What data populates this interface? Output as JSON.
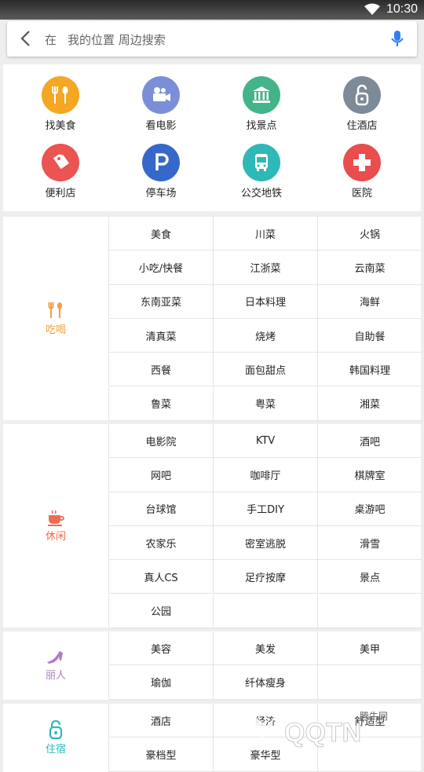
{
  "status_bar": {
    "time": "10:30"
  },
  "search": {
    "prefix": "在",
    "placeholder": "我的位置 周边搜索"
  },
  "quick_categories": [
    {
      "label": "找美食",
      "icon": "fork-spoon-icon",
      "color": "#f5a623"
    },
    {
      "label": "看电影",
      "icon": "movie-camera-icon",
      "color": "#7b8fd8"
    },
    {
      "label": "找景点",
      "icon": "landmark-icon",
      "color": "#43b38a"
    },
    {
      "label": "住酒店",
      "icon": "hotel-key-icon",
      "color": "#7d8a98"
    },
    {
      "label": "便利店",
      "icon": "price-tag-icon",
      "color": "#ea5451"
    },
    {
      "label": "停车场",
      "icon": "parking-icon",
      "color": "#3568c8"
    },
    {
      "label": "公交地铁",
      "icon": "bus-icon",
      "color": "#2fb8b8"
    },
    {
      "label": "医院",
      "icon": "medical-cross-icon",
      "color": "#ea4d4d"
    }
  ],
  "sections": [
    {
      "name": "吃喝",
      "color": "#f0a040",
      "icon": "fork-spoon-icon",
      "items": [
        "美食",
        "川菜",
        "火锅",
        "小吃/快餐",
        "江浙菜",
        "云南菜",
        "东南亚菜",
        "日本料理",
        "海鲜",
        "清真菜",
        "烧烤",
        "自助餐",
        "西餐",
        "面包甜点",
        "韩国料理",
        "鲁菜",
        "粤菜",
        "湘菜"
      ]
    },
    {
      "name": "休闲",
      "color": "#ef6b4f",
      "icon": "coffee-cup-icon",
      "items": [
        "电影院",
        "KTV",
        "酒吧",
        "网吧",
        "咖啡厅",
        "棋牌室",
        "台球馆",
        "手工DIY",
        "桌游吧",
        "农家乐",
        "密室逃脱",
        "滑雪",
        "真人CS",
        "足疗按摩",
        "景点",
        "公园",
        "",
        ""
      ]
    },
    {
      "name": "丽人",
      "color": "#b07cc6",
      "icon": "high-heel-icon",
      "items": [
        "美容",
        "美发",
        "美甲",
        "瑜伽",
        "纤体瘦身",
        ""
      ]
    },
    {
      "name": "住宿",
      "color": "#2fb8b8",
      "icon": "hotel-key-icon",
      "items": [
        "酒店",
        "经济",
        "舒适型",
        "豪档型",
        "豪华型",
        ""
      ]
    }
  ],
  "watermark": {
    "text": "QQTN.com",
    "sub": "腾牛网"
  }
}
